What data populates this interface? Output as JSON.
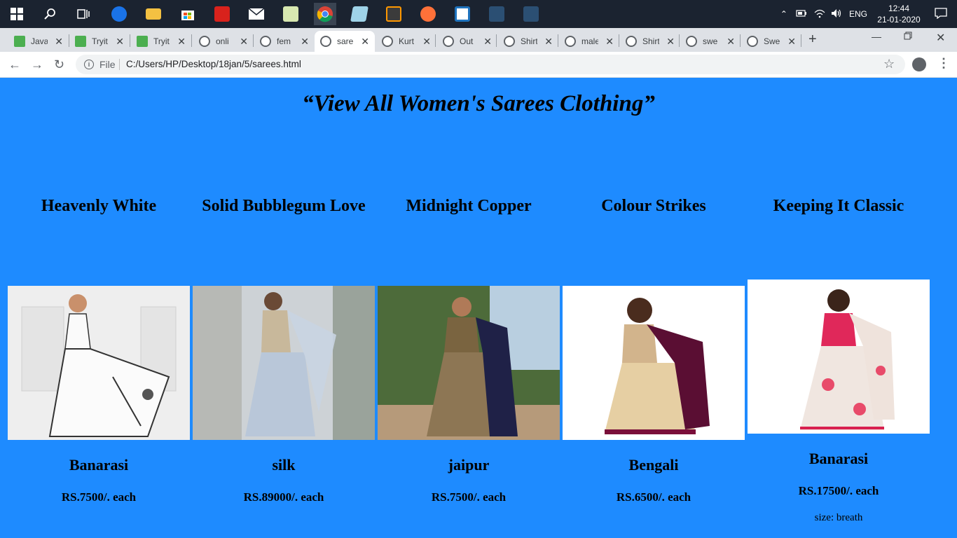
{
  "taskbar": {
    "tray": {
      "language": "ENG",
      "time": "12:44",
      "date": "21-01-2020"
    }
  },
  "browser": {
    "tabs": [
      {
        "label": "Java"
      },
      {
        "label": "Tryit"
      },
      {
        "label": "Tryit"
      },
      {
        "label": "onli"
      },
      {
        "label": "fem"
      },
      {
        "label": "sare"
      },
      {
        "label": "Kurt"
      },
      {
        "label": "Out"
      },
      {
        "label": "Shirt"
      },
      {
        "label": "male"
      },
      {
        "label": "Shirt"
      },
      {
        "label": "swe"
      },
      {
        "label": "Swe"
      }
    ],
    "address": {
      "scheme_label": "File",
      "url": "C:/Users/HP/Desktop/18jan/5/sarees.html"
    }
  },
  "page": {
    "title": "“View All Women's Sarees Clothing”",
    "products": [
      {
        "name": "Heavenly White",
        "type": "Banarasi",
        "price": "RS.7500/. each"
      },
      {
        "name": "Solid Bubblegum Love",
        "type": "silk",
        "price": "RS.89000/. each"
      },
      {
        "name": "Midnight Copper",
        "type": "jaipur",
        "price": "RS.7500/. each"
      },
      {
        "name": "Colour Strikes",
        "type": "Bengali",
        "price": "RS.6500/. each"
      },
      {
        "name": "Keeping It Classic",
        "type": "Banarasi",
        "price": "RS.17500/. each",
        "size": "size: breath"
      }
    ]
  }
}
